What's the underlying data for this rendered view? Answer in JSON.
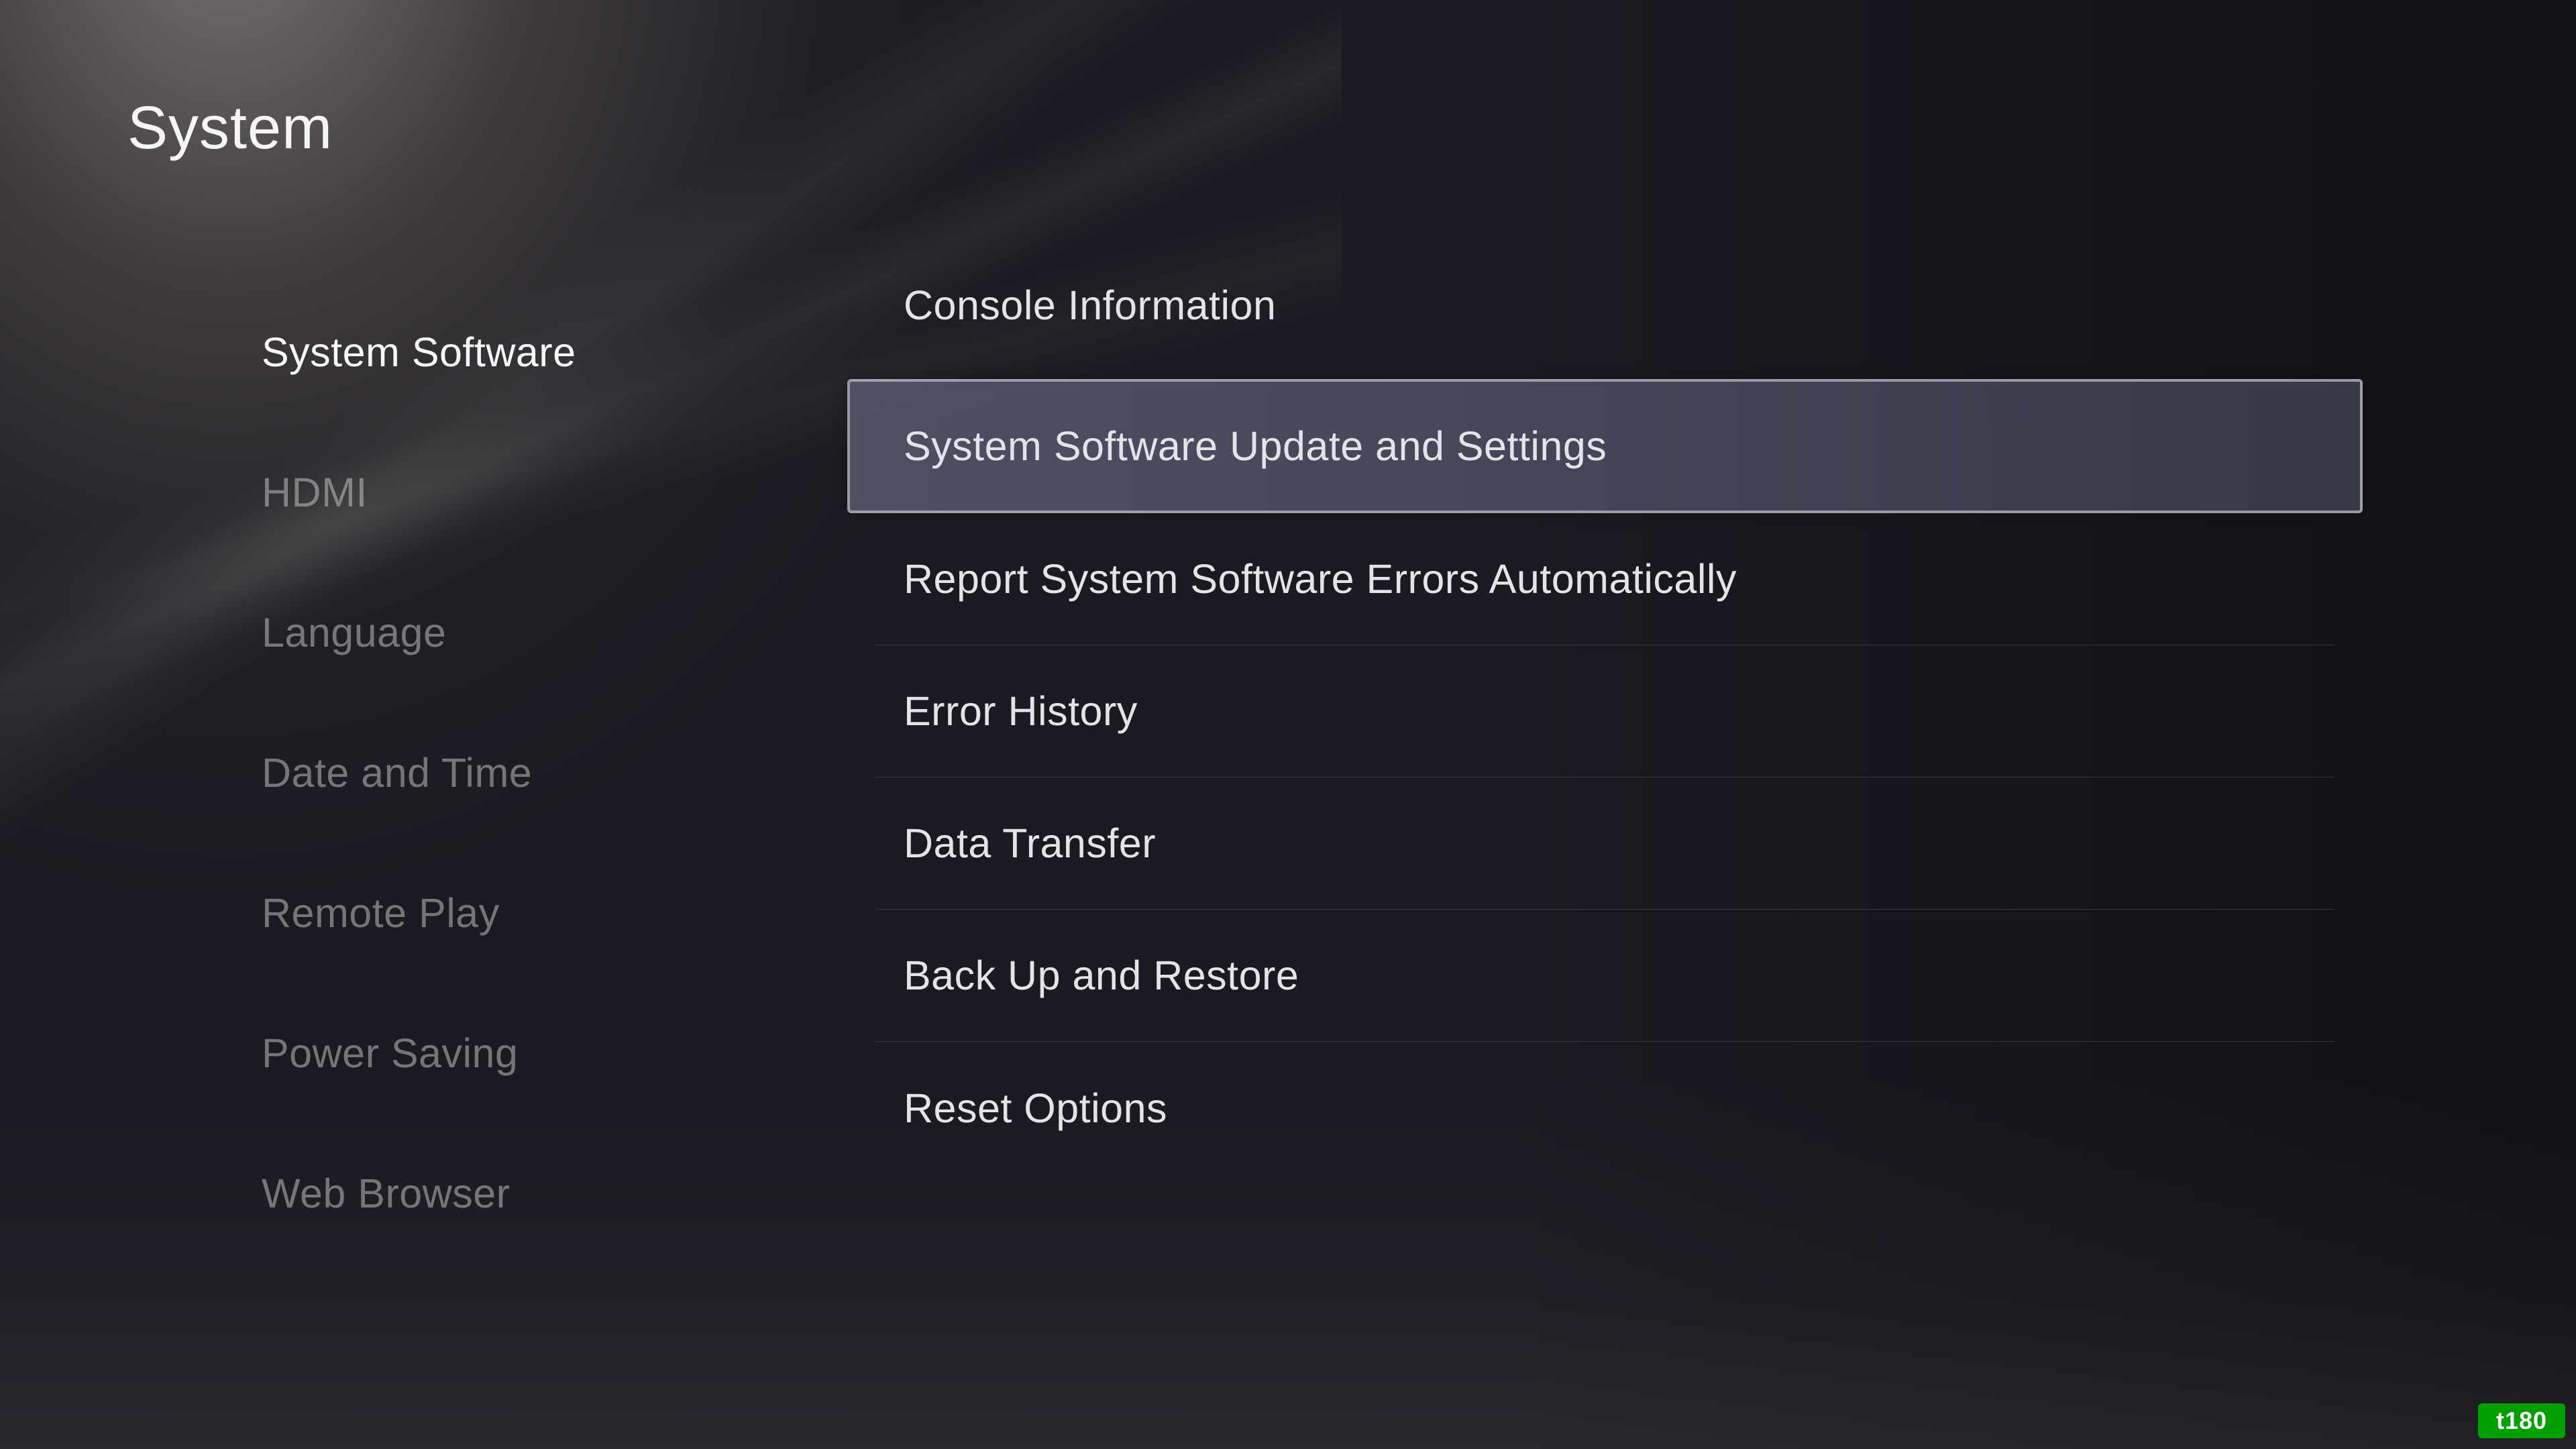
{
  "header": {
    "title": "System"
  },
  "sidebar": {
    "items": [
      {
        "label": "System Software",
        "active": true
      },
      {
        "label": "HDMI",
        "active": false
      },
      {
        "label": "Language",
        "active": false
      },
      {
        "label": "Date and Time",
        "active": false
      },
      {
        "label": "Remote Play",
        "active": false
      },
      {
        "label": "Power Saving",
        "active": false
      },
      {
        "label": "Web Browser",
        "active": false
      }
    ]
  },
  "content": {
    "items": [
      {
        "label": "Console Information",
        "highlighted": false
      },
      {
        "label": "System Software Update and Settings",
        "highlighted": true
      },
      {
        "label": "Report System Software Errors Automatically",
        "highlighted": false
      },
      {
        "label": "Error History",
        "highlighted": false
      },
      {
        "label": "Data Transfer",
        "highlighted": false
      },
      {
        "label": "Back Up and Restore",
        "highlighted": false
      },
      {
        "label": "Reset Options",
        "highlighted": false
      }
    ]
  },
  "watermark": {
    "text": "t180"
  }
}
